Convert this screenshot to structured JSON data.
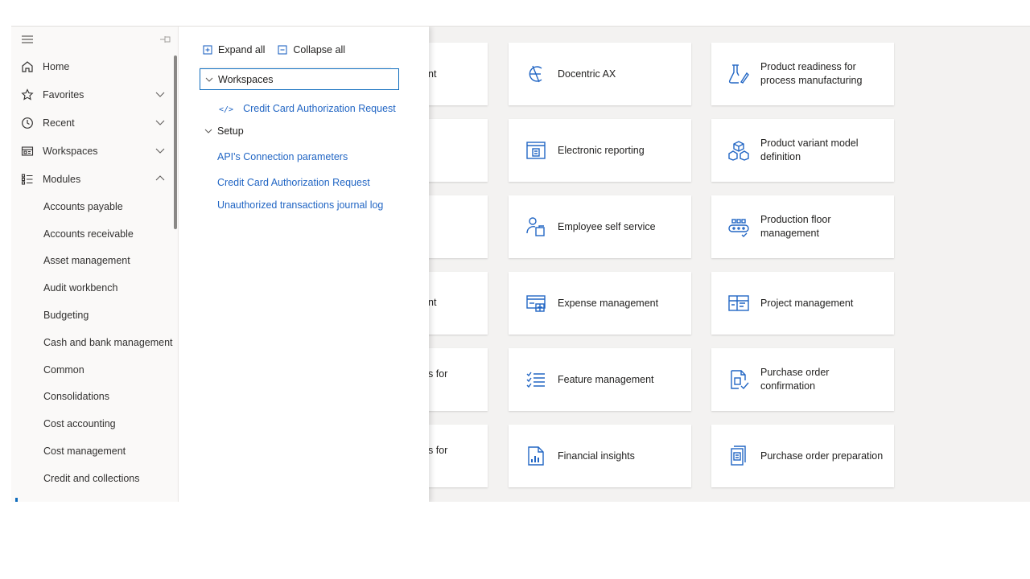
{
  "nav": {
    "top_items": [
      {
        "label": "Home",
        "icon": "home-icon",
        "chevron": ""
      },
      {
        "label": "Favorites",
        "icon": "star-icon",
        "chevron": "down"
      },
      {
        "label": "Recent",
        "icon": "clock-icon",
        "chevron": "down"
      },
      {
        "label": "Workspaces",
        "icon": "workspace-icon",
        "chevron": "down"
      },
      {
        "label": "Modules",
        "icon": "list-icon",
        "chevron": "up"
      }
    ],
    "modules": [
      "Accounts payable",
      "Accounts receivable",
      "Asset management",
      "Audit workbench",
      "Budgeting",
      "Cash and bank management",
      "Common",
      "Consolidations",
      "Cost accounting",
      "Cost management",
      "Credit and collections"
    ]
  },
  "flyout": {
    "expand_all": "Expand all",
    "collapse_all": "Collapse all",
    "workspaces_label": "Workspaces",
    "workspace_link": "Credit Card Authorization Request",
    "setup_label": "Setup",
    "setup_links": [
      "API's Connection parameters",
      "Credit Card Authorization Request",
      "Unauthorized transactions journal log"
    ]
  },
  "tiles": {
    "partial": [
      "nt",
      "",
      "",
      "nt",
      "s for",
      "s for"
    ],
    "column2": [
      {
        "label": "Docentric AX",
        "icon": "docentric-icon"
      },
      {
        "label": "Electronic reporting",
        "icon": "electronic-reporting-icon"
      },
      {
        "label": "Employee self service",
        "icon": "employee-icon"
      },
      {
        "label": "Expense management",
        "icon": "expense-icon"
      },
      {
        "label": "Feature management",
        "icon": "feature-list-icon"
      },
      {
        "label": "Financial insights",
        "icon": "financial-insights-icon"
      }
    ],
    "column3": [
      {
        "label": "Product readiness for process manufacturing",
        "icon": "flask-icon"
      },
      {
        "label": "Product variant model definition",
        "icon": "cubes-icon"
      },
      {
        "label": "Production floor management",
        "icon": "production-floor-icon"
      },
      {
        "label": "Project management",
        "icon": "project-icon"
      },
      {
        "label": "Purchase order confirmation",
        "icon": "po-confirmation-icon"
      },
      {
        "label": "Purchase order preparation",
        "icon": "po-preparation-icon"
      }
    ]
  },
  "colors": {
    "accent": "#0f6cbd",
    "link": "#2266c4",
    "icon": "#2266c4"
  }
}
